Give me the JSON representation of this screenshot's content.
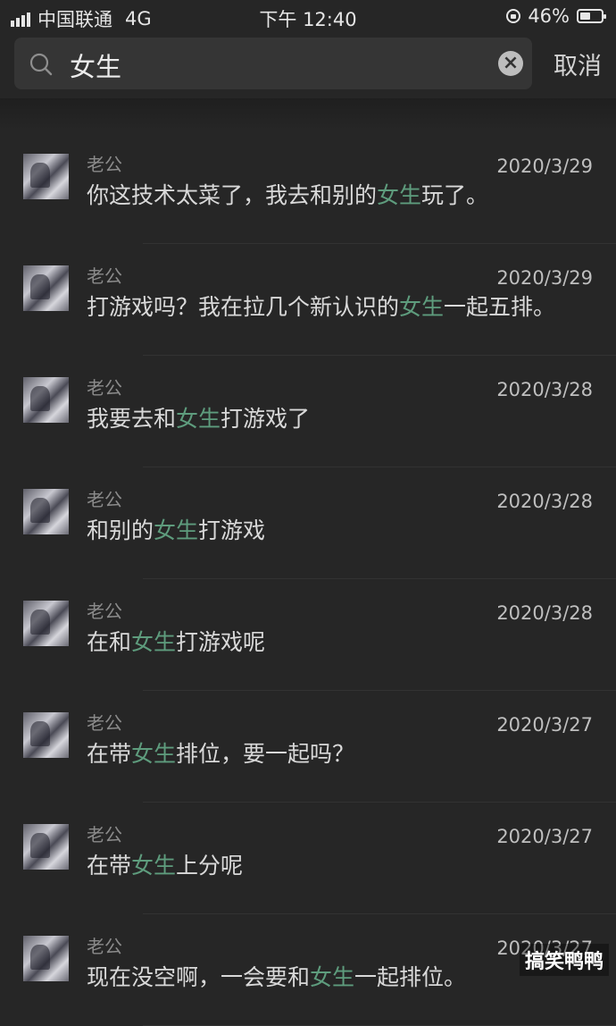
{
  "status_bar": {
    "carrier": "中国联通",
    "network": "4G",
    "time": "下午 12:40",
    "battery": "46%"
  },
  "search": {
    "query": "女生",
    "cancel_label": "取消"
  },
  "results": [
    {
      "sender": "老公",
      "date": "2020/3/29",
      "before": "你这技术太菜了，我去和别的",
      "match": "女生",
      "after": "玩了。"
    },
    {
      "sender": "老公",
      "date": "2020/3/29",
      "before": "打游戏吗？我在拉几个新认识的",
      "match": "女生",
      "after": "一起五排。"
    },
    {
      "sender": "老公",
      "date": "2020/3/28",
      "before": "我要去和",
      "match": "女生",
      "after": "打游戏了"
    },
    {
      "sender": "老公",
      "date": "2020/3/28",
      "before": "和别的",
      "match": "女生",
      "after": "打游戏"
    },
    {
      "sender": "老公",
      "date": "2020/3/28",
      "before": "在和",
      "match": "女生",
      "after": "打游戏呢"
    },
    {
      "sender": "老公",
      "date": "2020/3/27",
      "before": "在带",
      "match": "女生",
      "after": "排位，要一起吗？"
    },
    {
      "sender": "老公",
      "date": "2020/3/27",
      "before": "在带",
      "match": "女生",
      "after": "上分呢"
    },
    {
      "sender": "老公",
      "date": "2020/3/27",
      "before": "现在没空啊，一会要和",
      "match": "女生",
      "after": "一起排位。"
    }
  ],
  "watermark": "搞笑鸭鸭",
  "colors": {
    "background": "#262626",
    "highlight": "#5e9c7d"
  }
}
